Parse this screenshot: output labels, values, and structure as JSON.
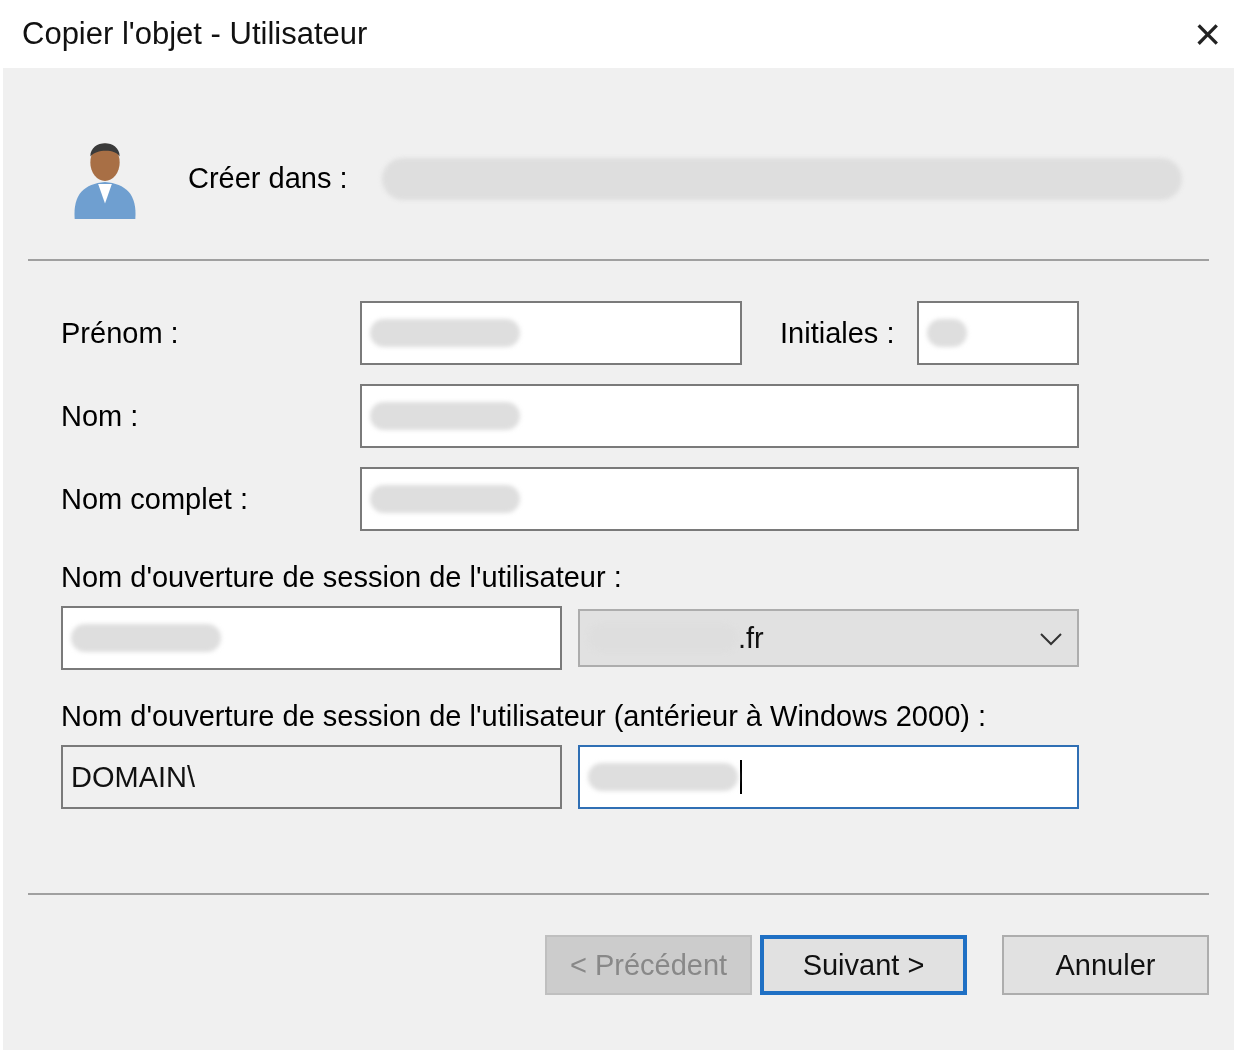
{
  "window": {
    "title": "Copier l'objet - Utilisateur",
    "close": "×"
  },
  "create_in": {
    "label": "Créer dans :",
    "redacted": true
  },
  "name_fields": [
    {
      "label": "Prénom :",
      "redacted": true,
      "side_label": "Initiales :",
      "side_redacted": true
    },
    {
      "label": "Nom :",
      "redacted": true
    },
    {
      "label": "Nom complet :",
      "redacted": true
    }
  ],
  "logon": {
    "label": "Nom d'ouverture de session de l'utilisateur :",
    "fields": [
      {
        "dropdown": false,
        "redacted": true,
        "disabled": false,
        "focused": false
      },
      {
        "dropdown": true,
        "value": ".fr",
        "redacted": true,
        "disabled": false,
        "focused": false
      }
    ]
  },
  "logon_pre2000": {
    "label": "Nom d'ouverture de session de l'utilisateur (antérieur à Windows 2000) :",
    "fields": [
      {
        "dropdown": false,
        "value": "DOMAIN\\",
        "redacted": false,
        "disabled": true,
        "focused": false
      },
      {
        "dropdown": false,
        "redacted": true,
        "disabled": false,
        "focused": true
      }
    ]
  },
  "buttons": [
    {
      "label": "< Précédent",
      "disabled": true,
      "default": false
    },
    {
      "label": "Suivant >",
      "disabled": false,
      "default": true
    },
    {
      "label": "Annuler",
      "disabled": false,
      "default": false
    }
  ]
}
